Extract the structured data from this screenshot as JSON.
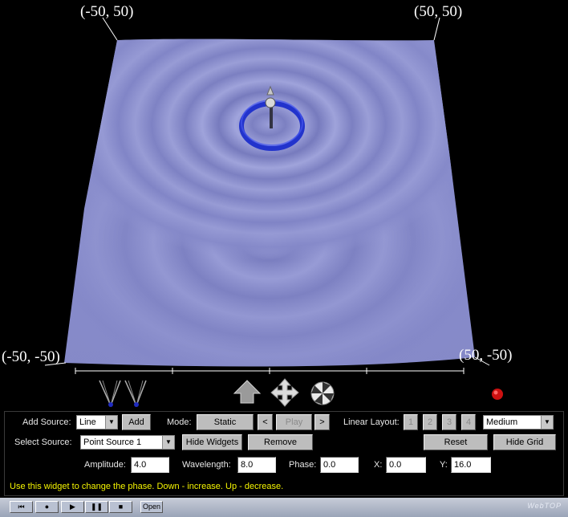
{
  "corners": {
    "top_left": "(-50, 50)",
    "top_right": "(50, 50)",
    "bottom_left": "(-50, -50)",
    "bottom_right": "(50, -50)"
  },
  "colors": {
    "surface": "#8f93d0",
    "ring": "#2a3ad8",
    "record_dot": "#cc1111",
    "hint_text": "#f5f500"
  },
  "widgets": {
    "line_source_icons": [
      "line-source-icon",
      "line-source-icon"
    ],
    "nav_icons": [
      "elevate-icon",
      "pan-icon",
      "rotate-icon"
    ],
    "record_icon": "record-icon"
  },
  "controls": {
    "add_source_label": "Add Source:",
    "add_source_value": "Line",
    "add_button": "Add",
    "mode_label": "Mode:",
    "mode_button": "Static",
    "prev_button": "<",
    "play_button": "Play",
    "next_button": ">",
    "linear_layout_label": "Linear Layout:",
    "layout_buttons": [
      "1",
      "2",
      "3",
      "4"
    ],
    "quality_value": "Medium",
    "select_source_label": "Select Source:",
    "select_source_value": "Point Source 1",
    "hide_widgets_button": "Hide Widgets",
    "remove_button": "Remove",
    "reset_button": "Reset",
    "hide_grid_button": "Hide Grid",
    "amplitude_label": "Amplitude:",
    "amplitude_value": "4.0",
    "wavelength_label": "Wavelength:",
    "wavelength_value": "8.0",
    "phase_label": "Phase:",
    "phase_value": "0.0",
    "x_label": "X:",
    "x_value": "0.0",
    "y_label": "Y:",
    "y_value": "16.0",
    "hint": "Use this widget to change the phase.  Down - increase.  Up - decrease."
  },
  "player": {
    "buttons": [
      "⏮",
      "●",
      "▶",
      "❚❚",
      "■"
    ],
    "open_button": "Open",
    "brand": "WebTOP"
  }
}
